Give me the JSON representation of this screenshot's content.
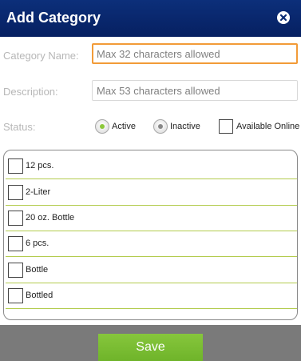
{
  "header": {
    "title": "Add Category"
  },
  "form": {
    "category_name": {
      "label": "Category Name:",
      "placeholder": "Max 32 characters allowed"
    },
    "description": {
      "label": "Description:",
      "placeholder": "Max 53 characters allowed"
    },
    "status": {
      "label": "Status:",
      "options": [
        {
          "label": "Active",
          "selected": true
        },
        {
          "label": "Inactive",
          "selected": false
        }
      ],
      "available_online_label": "Available Online",
      "available_online_checked": false
    }
  },
  "list": {
    "items": [
      {
        "label": "12 pcs.",
        "checked": false
      },
      {
        "label": "2-Liter",
        "checked": false
      },
      {
        "label": "20 oz. Bottle",
        "checked": false
      },
      {
        "label": "6 pcs.",
        "checked": false
      },
      {
        "label": "Bottle",
        "checked": false
      },
      {
        "label": "Bottled",
        "checked": false
      }
    ]
  },
  "footer": {
    "save_label": "Save"
  },
  "colors": {
    "header": "#0b2c73",
    "accent_green": "#7cbd34",
    "focus_orange": "#f29b38",
    "separator": "#b3cc4e",
    "footer_bg": "#7a7a7a"
  }
}
